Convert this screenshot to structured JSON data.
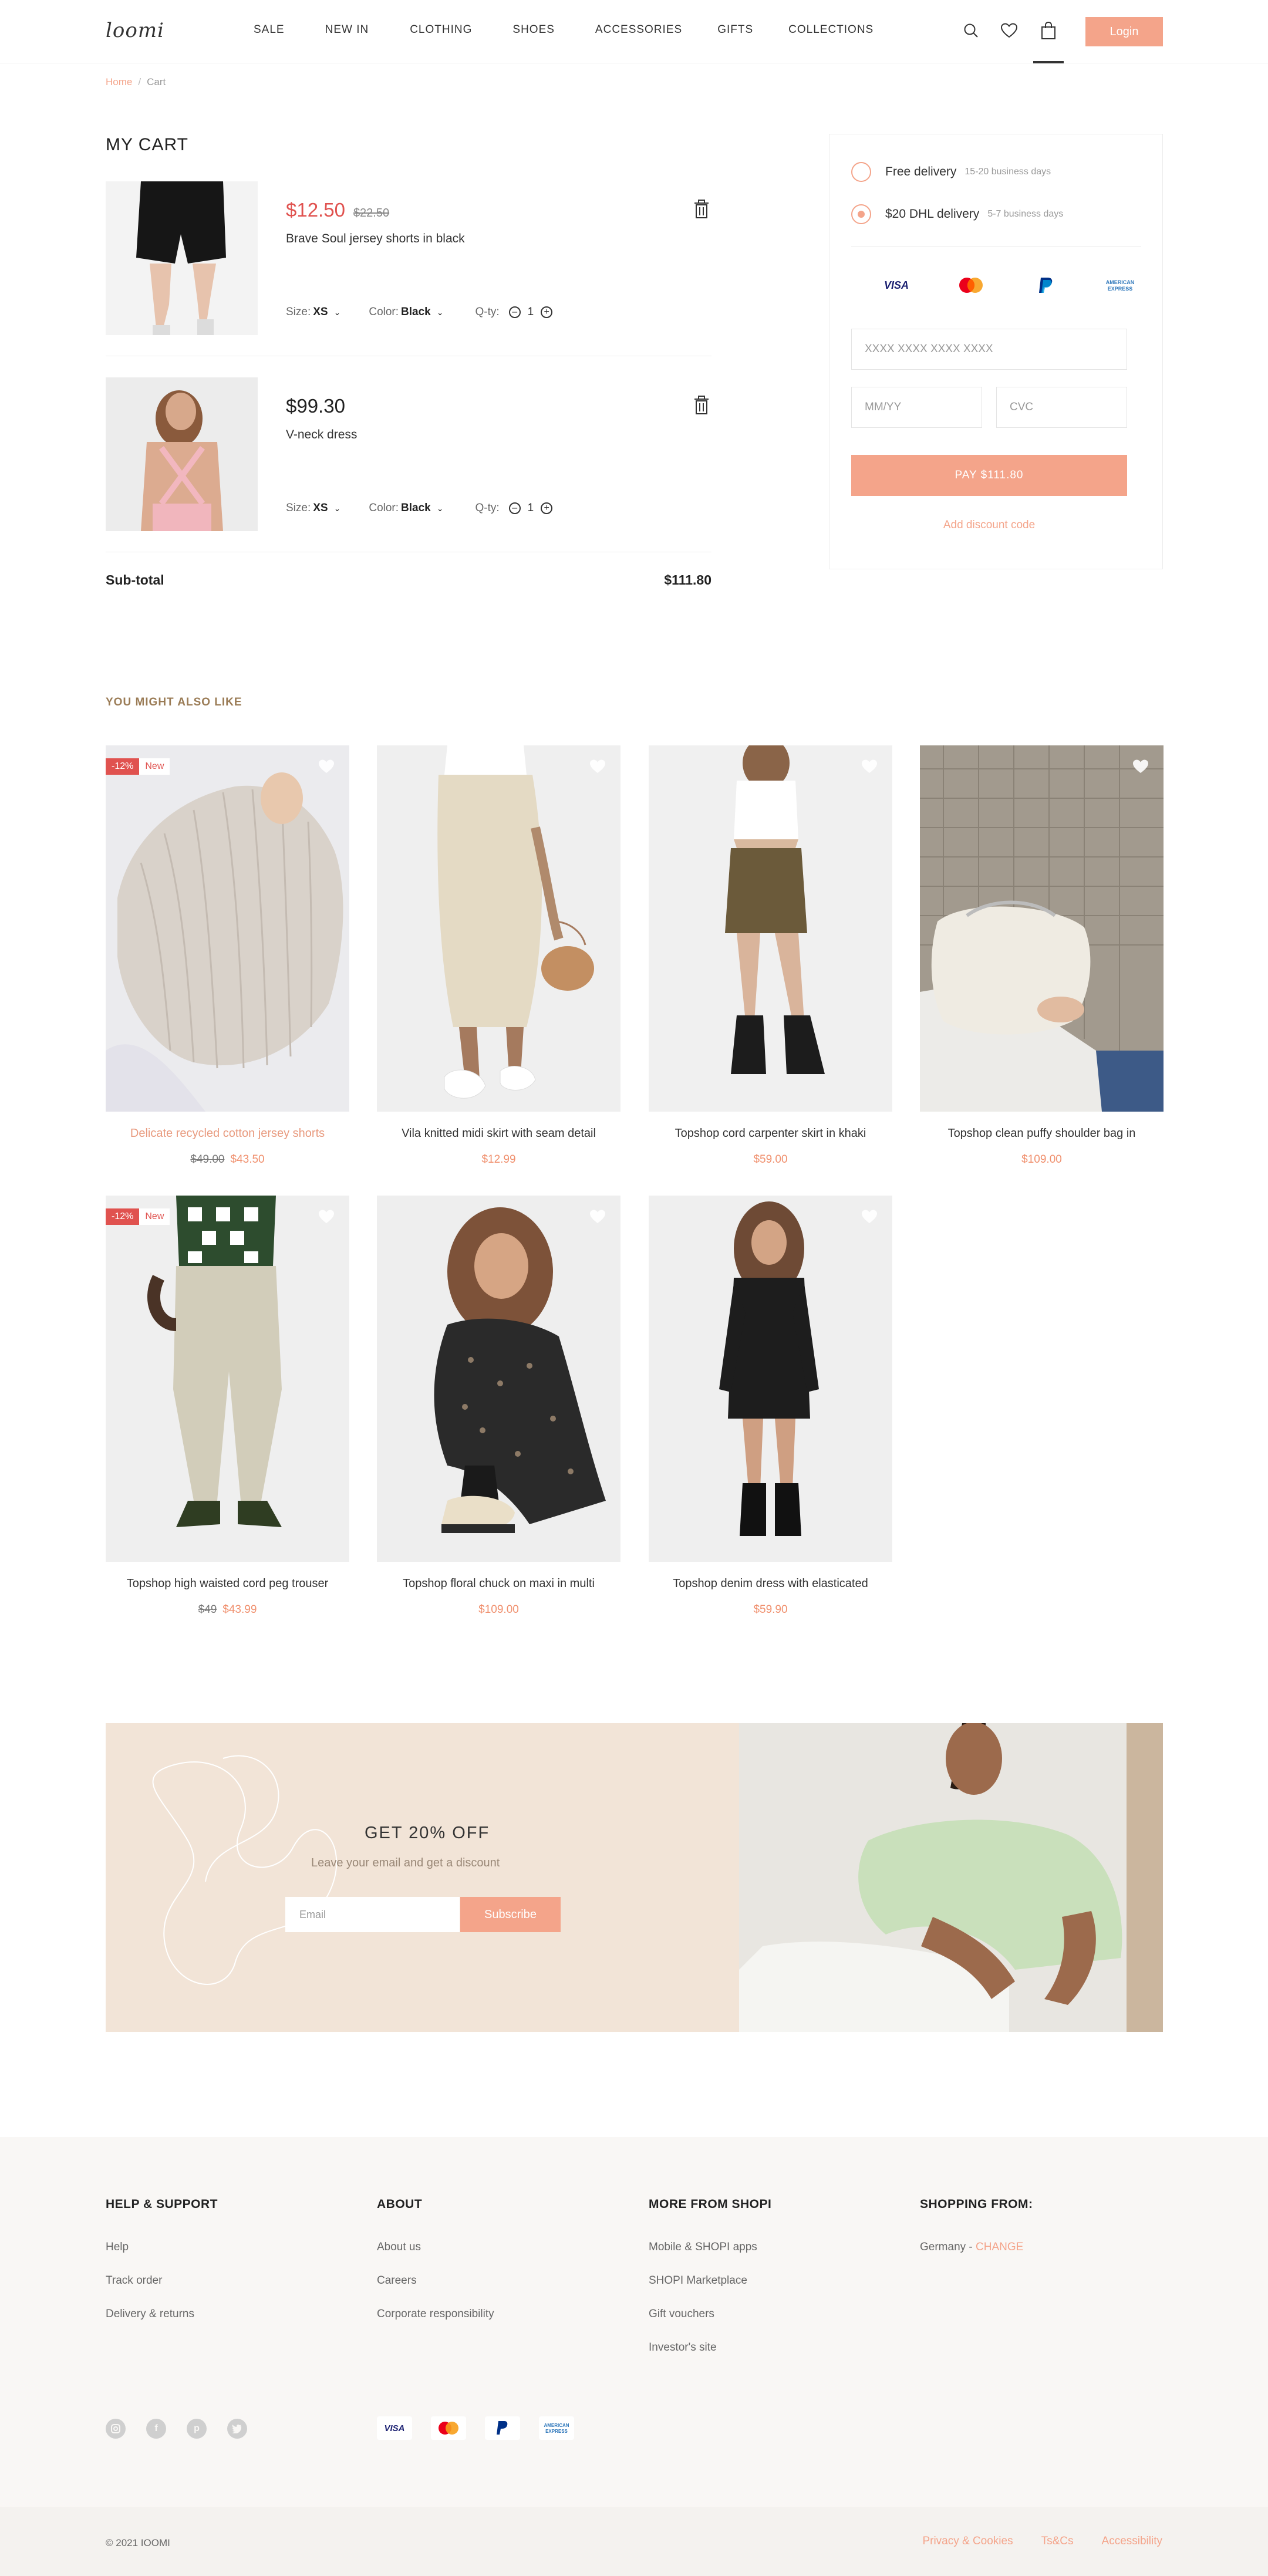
{
  "header": {
    "logo": "loomi",
    "nav": [
      "SALE",
      "NEW IN",
      "CLOTHING",
      "SHOES",
      "ACCESSORIES",
      "GIFTS",
      "COLLECTIONS"
    ],
    "login_label": "Login"
  },
  "breadcrumb": {
    "home": "Home",
    "separator": "/",
    "current": "Cart"
  },
  "cart": {
    "title": "MY CART",
    "items": [
      {
        "price": "$12.50",
        "old_price": "$22.50",
        "name": "Brave Soul jersey shorts in black",
        "size_label": "Size:",
        "size": "XS",
        "color_label": "Color:",
        "color": "Black",
        "qty_label": "Q-ty:",
        "qty": "1"
      },
      {
        "price": "$99.30",
        "old_price": "",
        "name": "V-neck dress",
        "size_label": "Size:",
        "size": "XS",
        "color_label": "Color:",
        "color": "Black",
        "qty_label": "Q-ty:",
        "qty": "1"
      }
    ],
    "subtotal_label": "Sub-total",
    "subtotal_value": "$111.80"
  },
  "checkout": {
    "delivery_options": [
      {
        "label": "Free delivery",
        "detail": "15-20 business days",
        "selected": false
      },
      {
        "label": "$20 DHL delivery",
        "detail": "5-7 business days",
        "selected": true
      }
    ],
    "payment_methods": [
      "VISA",
      "Mastercard",
      "PayPal",
      "AMERICAN EXPRESS"
    ],
    "card_number_placeholder": "XXXX   XXXX   XXXX   XXXX",
    "expiry_placeholder": "MM/YY",
    "cvc_placeholder": "CVC",
    "pay_label": "PAY $111.80",
    "discount_label": "Add discount code"
  },
  "recommendations": {
    "heading": "YOU MIGHT ALSO LIKE",
    "products": [
      {
        "title": "Delicate recycled cotton jersey shorts",
        "old_price": "$49.00",
        "price": "$43.50",
        "discount": "-12%",
        "new": "New",
        "highlight": true
      },
      {
        "title": "Vila knitted midi skirt with seam detail",
        "old_price": "",
        "price": "$12.99",
        "discount": "",
        "new": ""
      },
      {
        "title": "Topshop cord carpenter skirt in khaki",
        "old_price": "",
        "price": "$59.00",
        "discount": "",
        "new": ""
      },
      {
        "title": "Topshop clean puffy shoulder bag in",
        "old_price": "",
        "price": "$109.00",
        "discount": "",
        "new": ""
      },
      {
        "title": "Topshop high waisted cord peg trouser",
        "old_price": "$49",
        "price": "$43.99",
        "discount": "-12%",
        "new": "New"
      },
      {
        "title": "Topshop floral chuck on maxi in multi",
        "old_price": "",
        "price": "$109.00",
        "discount": "",
        "new": ""
      },
      {
        "title": "Topshop denim dress with elasticated",
        "old_price": "",
        "price": "$59.90",
        "discount": "",
        "new": ""
      }
    ]
  },
  "newsletter": {
    "title": "GET 20% OFF",
    "subtitle": "Leave your email and get a discount",
    "email_placeholder": "Email",
    "subscribe_label": "Subscribe"
  },
  "footer": {
    "columns": [
      {
        "heading": "HELP & SUPPORT",
        "links": [
          "Help",
          "Track order",
          "Delivery & returns"
        ]
      },
      {
        "heading": "ABOUT",
        "links": [
          "About us",
          "Careers",
          "Corporate responsibility"
        ]
      },
      {
        "heading": "MORE FROM SHOPI",
        "links": [
          "Mobile & SHOPI apps",
          "SHOPI Marketplace",
          "Gift vouchers",
          "Investor's site"
        ]
      },
      {
        "heading": "SHOPPING FROM:",
        "country": "Germany - ",
        "change": "CHANGE"
      }
    ],
    "social_icons": [
      "instagram-icon",
      "facebook-icon",
      "pinterest-icon",
      "twitter-icon"
    ],
    "payment_methods": [
      "VISA",
      "Mastercard",
      "PayPal",
      "AMERICAN EXPRESS"
    ],
    "copyright": "© 2021 IOOMI",
    "legal_links": [
      "Privacy & Cookies",
      "Ts&Cs",
      "Accessibility"
    ]
  },
  "colors": {
    "accent": "#f4a48a",
    "sale_red": "#e0524f",
    "promo_bg": "#f2e4d7",
    "footer_bg": "#f9f7f5"
  }
}
